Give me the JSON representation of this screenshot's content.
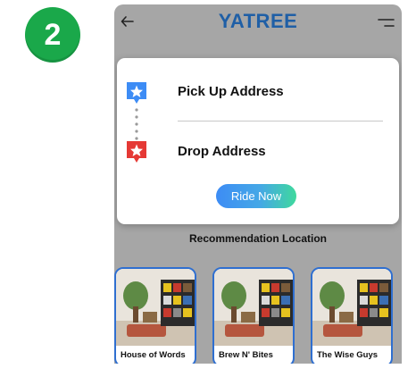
{
  "step": {
    "number": "2",
    "color": "#1aa84a"
  },
  "app": {
    "logo": "YATREE",
    "brand_color": "#1f5fa6",
    "back_icon": "arrow-left-icon",
    "menu_icon": "hamburger-menu-icon"
  },
  "booking": {
    "pickup_label": "Pick Up Address",
    "drop_label": "Drop  Address",
    "pickup_icon": "star-pin-blue-icon",
    "drop_icon": "star-pin-red-icon",
    "pickup_color": "#3d8cf5",
    "drop_color": "#e53935",
    "ride_button": "Ride Now"
  },
  "recommendations": {
    "title": "Recommendation Location",
    "items": [
      {
        "name": "House of Words"
      },
      {
        "name": "Brew N' Bites"
      },
      {
        "name": "The Wise Guys"
      }
    ]
  }
}
